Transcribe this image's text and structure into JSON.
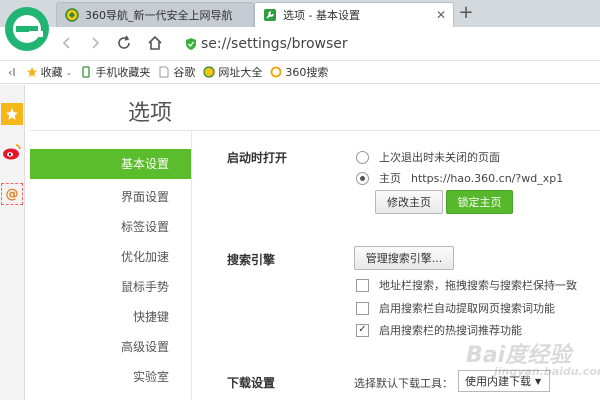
{
  "tabs": [
    {
      "title": "360导航_新一代安全上网导航",
      "active": false
    },
    {
      "title": "选项 - 基本设置",
      "active": true
    }
  ],
  "address": {
    "url": "se://settings/browser"
  },
  "bookmarks": [
    {
      "label": "收藏",
      "icon": "star-icon"
    },
    {
      "label": "手机收藏夹",
      "icon": "phone-icon"
    },
    {
      "label": "谷歌",
      "icon": "page-icon"
    },
    {
      "label": "网址大全",
      "icon": "360-icon"
    },
    {
      "label": "360搜索",
      "icon": "search-circle-icon"
    }
  ],
  "page": {
    "title": "选项"
  },
  "nav": [
    {
      "label": "基本设置",
      "active": true
    },
    {
      "label": "界面设置"
    },
    {
      "label": "标签设置"
    },
    {
      "label": "优化加速"
    },
    {
      "label": "鼠标手势"
    },
    {
      "label": "快捷键"
    },
    {
      "label": "高级设置"
    },
    {
      "label": "实验室"
    }
  ],
  "startup": {
    "label": "启动时打开",
    "option_last": "上次退出时未关闭的页面",
    "option_home": "主页",
    "home_url": "https://hao.360.cn/?wd_xp1",
    "modify_btn": "修改主页",
    "lock_btn": "锁定主页"
  },
  "search": {
    "label": "搜索引擎",
    "manage_btn": "管理搜索引擎...",
    "opt1": "地址栏搜索，拖拽搜索与搜索栏保持一致",
    "opt2": "启用搜索栏自动提取网页搜索词功能",
    "opt3": "启用搜索栏的热搜词推荐功能"
  },
  "download": {
    "label": "下载设置",
    "select_label": "选择默认下载工具：",
    "select_value": "使用内建下载"
  },
  "colors": {
    "accent": "#5bbd2b",
    "logo": "#21b573"
  },
  "watermark": {
    "line1": "Bai度经验",
    "line2": "jingyan.baidu.com"
  }
}
